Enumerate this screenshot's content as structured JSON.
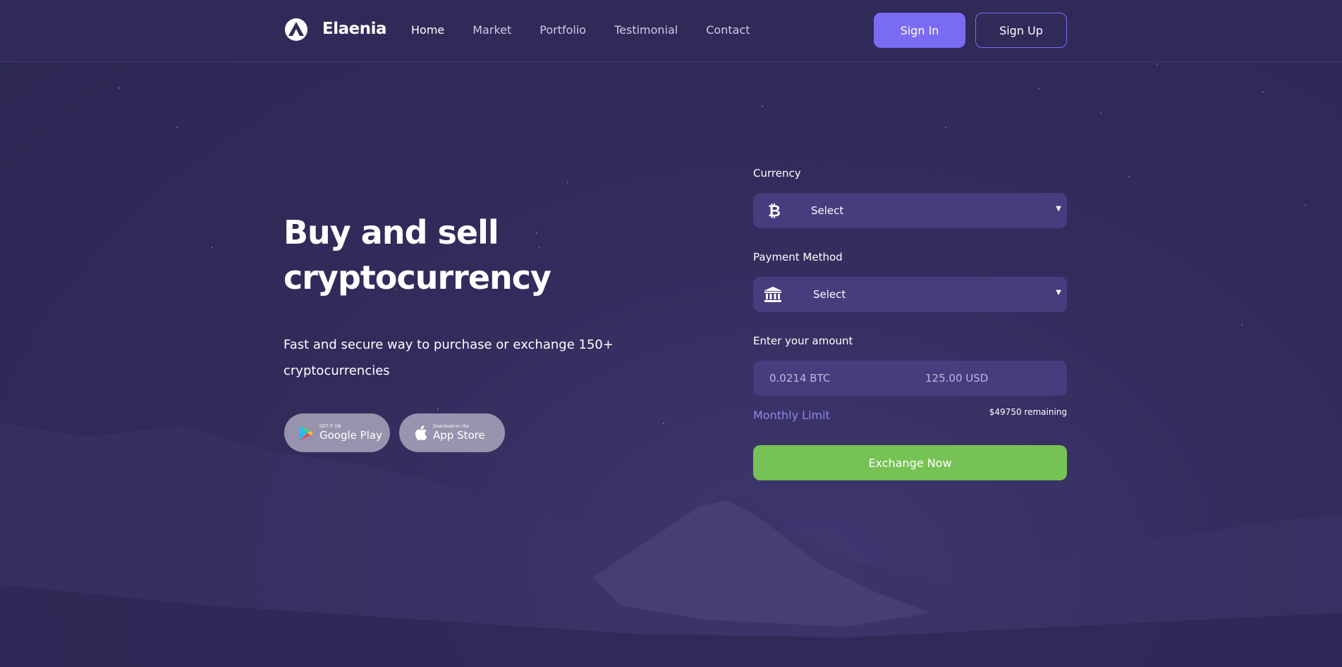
{
  "brand": {
    "name": "Elaenia"
  },
  "nav": {
    "items": [
      {
        "label": "Home",
        "active": true
      },
      {
        "label": "Market"
      },
      {
        "label": "Portfolio"
      },
      {
        "label": "Testimonial"
      },
      {
        "label": "Contact"
      }
    ]
  },
  "auth": {
    "signin_label": "Sign In",
    "signup_label": "Sign Up"
  },
  "hero": {
    "title_line1": "Buy and sell",
    "title_line2": "cryptocurrency",
    "subtitle_line1": "Fast and secure way to purchase or exchange 150+",
    "subtitle_line2": "cryptocurrencies",
    "google_play": {
      "small": "GET IT ON",
      "big": "Google Play"
    },
    "app_store": {
      "small": "Download on the",
      "big": "App Store"
    }
  },
  "form": {
    "currency_label": "Currency",
    "currency_value": "Select",
    "payment_label": "Payment Method",
    "payment_value": "Select",
    "amount_label": "Enter your amount",
    "amount_btc": "0.0214 BTC",
    "amount_usd": "125.00 USD",
    "monthly_limit_label": "Monthly Limit",
    "remaining_text": "$49750 remaining",
    "exchange_label": "Exchange Now"
  },
  "colors": {
    "background": "#322c5c",
    "accent": "#7a6cf2",
    "field": "#463c7e",
    "success": "#77c254"
  },
  "icons": {
    "logo": "elaenia-logo-icon",
    "currency": "bitcoin-icon",
    "payment": "bank-icon",
    "caret": "caret-down-icon",
    "google_play": "google-play-icon",
    "app_store": "apple-icon"
  }
}
